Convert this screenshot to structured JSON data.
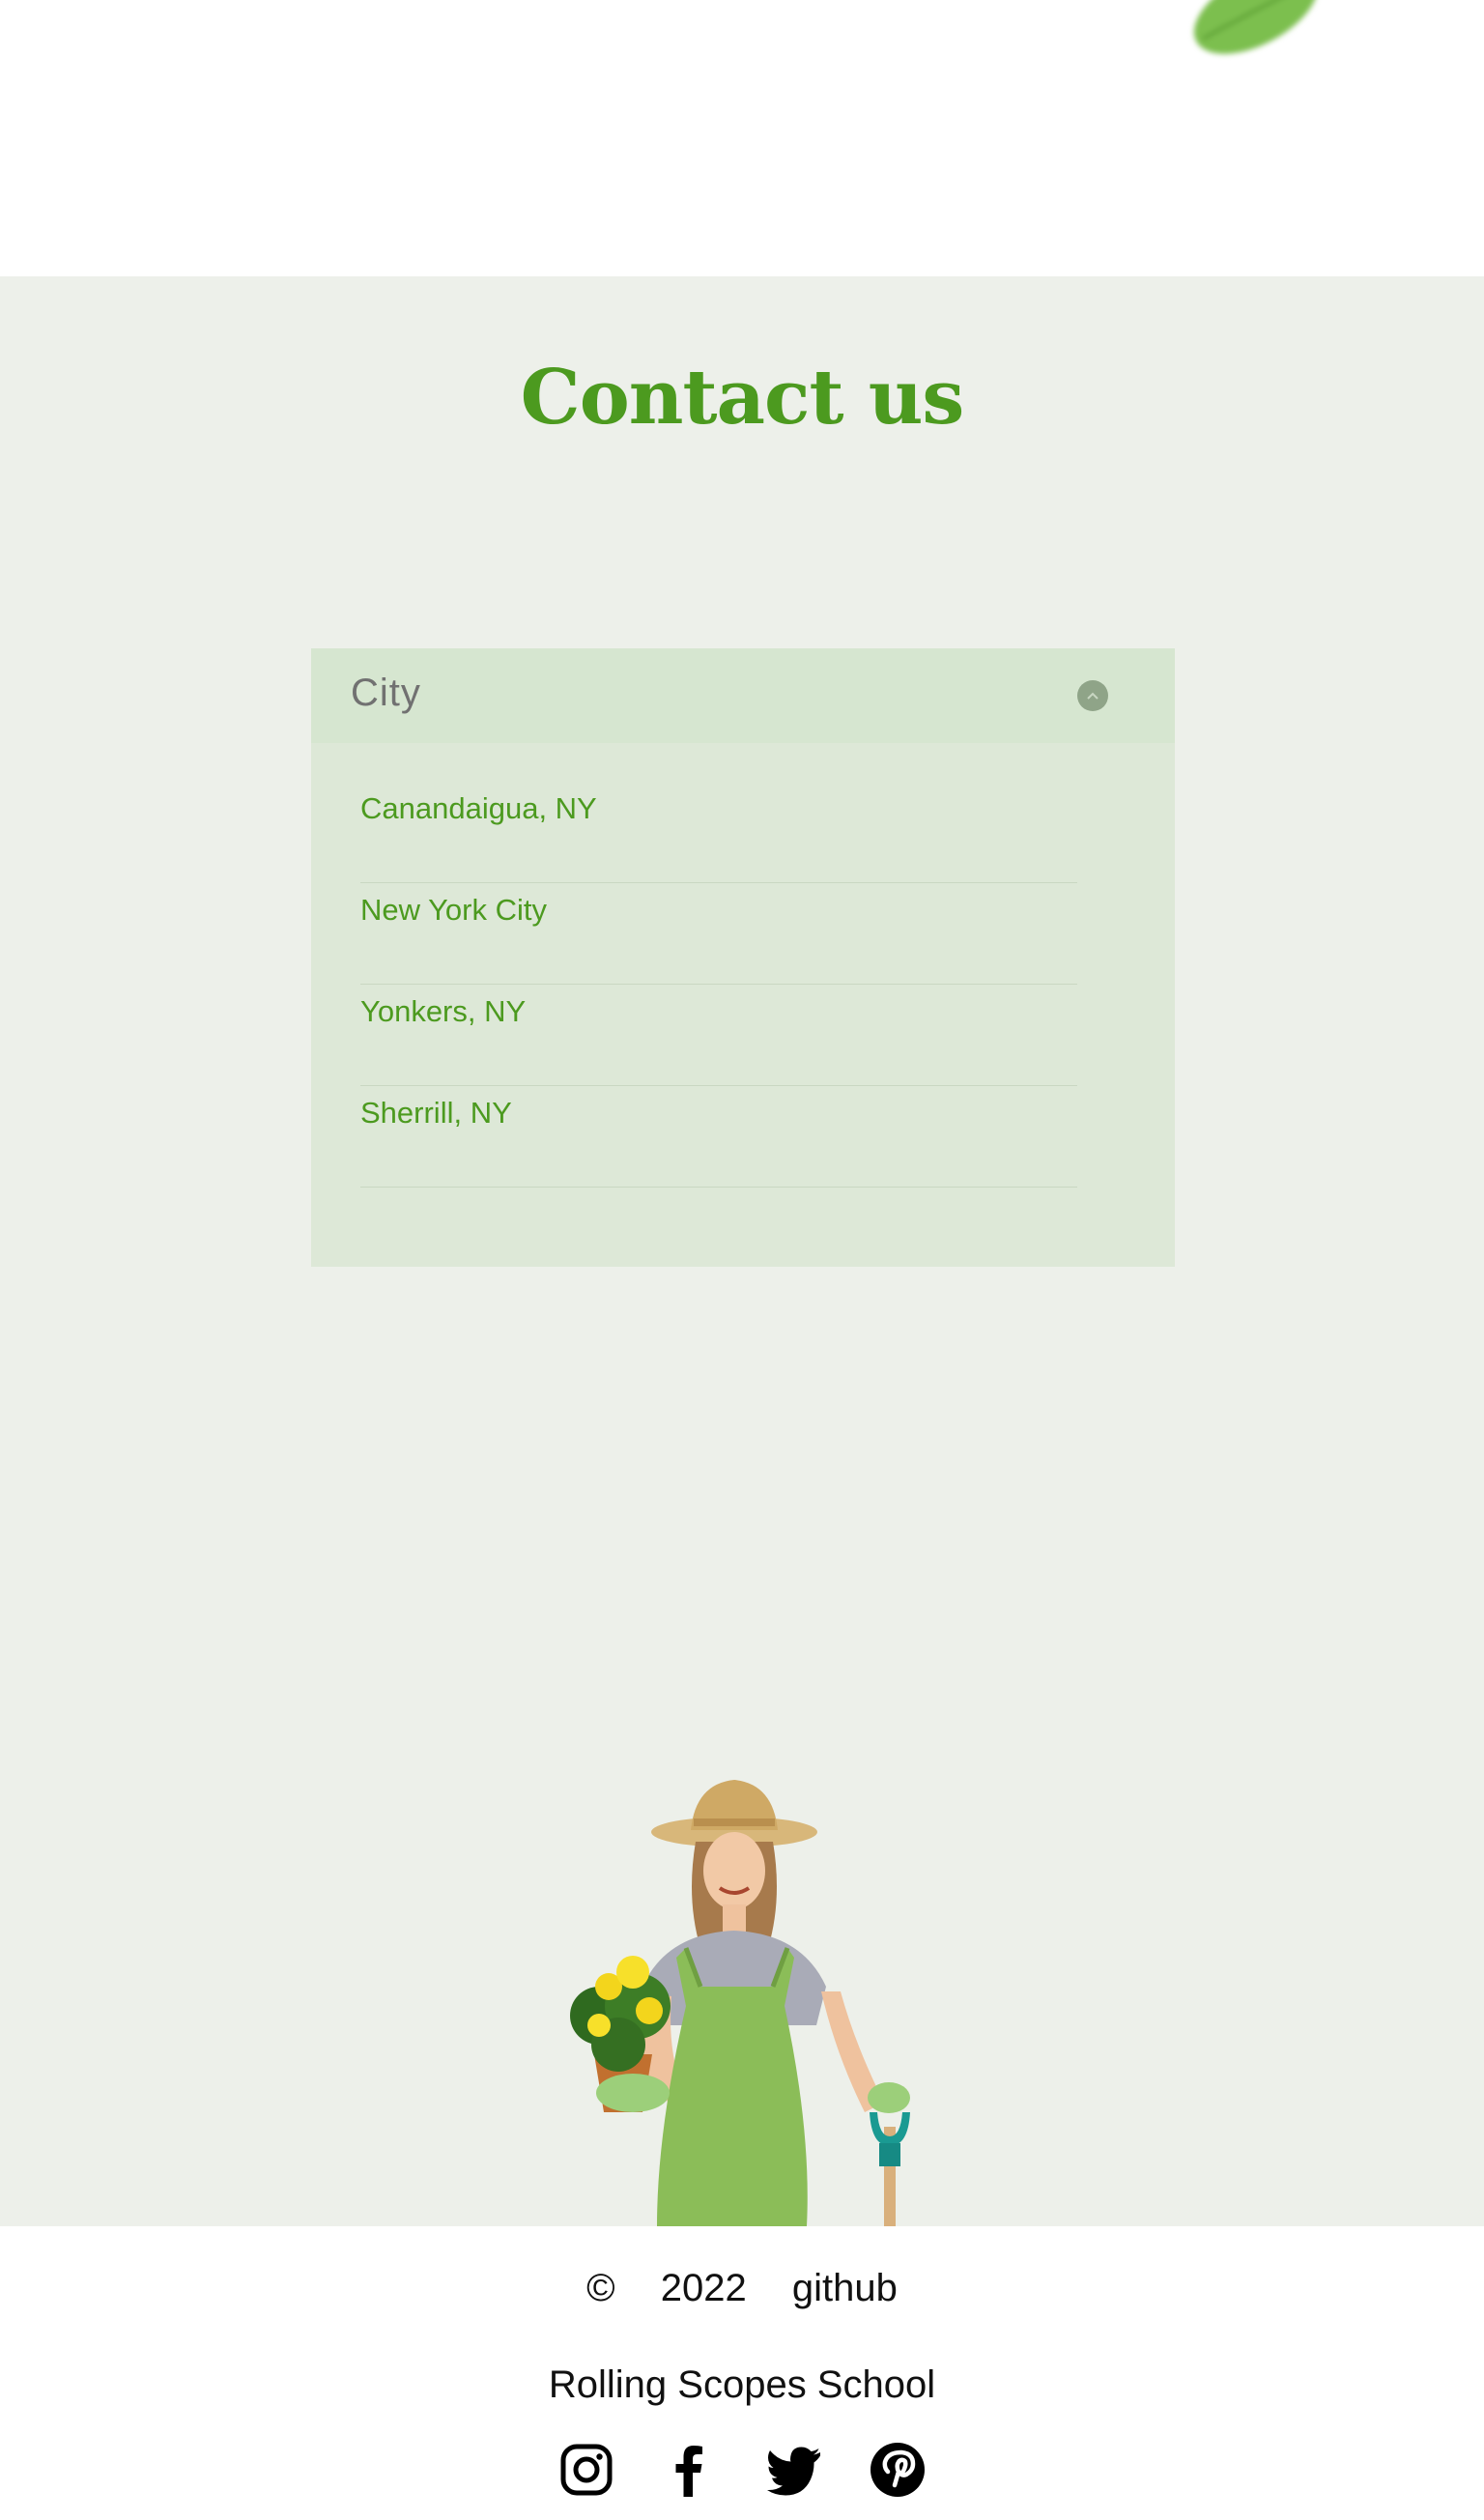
{
  "contact": {
    "title": "Contact us"
  },
  "city_dropdown": {
    "label": "City",
    "options": [
      "Canandaigua, NY",
      "New York City",
      "Yonkers, NY",
      "Sherrill, NY"
    ]
  },
  "footer": {
    "copyright_symbol": "©",
    "year": "2022",
    "github_link": "github",
    "school": "Rolling Scopes School"
  },
  "icons": {
    "chevron": "chevron-up-icon",
    "socials": [
      "instagram-icon",
      "facebook-icon",
      "twitter-icon",
      "pinterest-icon"
    ]
  },
  "colors": {
    "accent": "#4c9a1f",
    "section_bg": "#edf0ea",
    "dropdown_bg": "#dde8d7",
    "dropdown_header_bg": "#d6e6d0"
  }
}
